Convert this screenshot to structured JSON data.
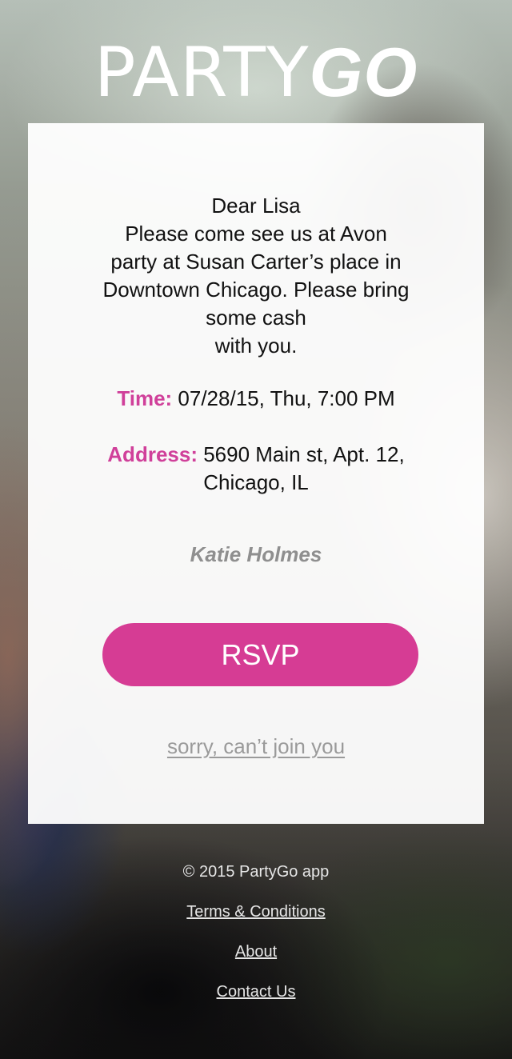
{
  "brand": {
    "logo_light": "PARTY",
    "logo_bold": "GO"
  },
  "invitation": {
    "greeting": "Dear Lisa",
    "lines": [
      "Please come see us at Avon",
      "party at Susan Carter’s place in",
      "Downtown Chicago. Please bring",
      "some cash",
      "with you."
    ],
    "time_label": "Time:",
    "time_value": " 07/28/15, Thu, 7:00 PM",
    "address_label": "Address:",
    "address_value_1": " 5690 Main st, Apt. 12,",
    "address_value_2": "Chicago, IL",
    "sender": "Katie Holmes",
    "rsvp_label": "RSVP",
    "decline_label": "sorry, can’t join you"
  },
  "footer": {
    "copyright": "© 2015 PartyGo app",
    "terms": "Terms & Conditions",
    "about": "About",
    "contact": "Contact Us"
  },
  "colors": {
    "accent": "#d63c94",
    "label": "#d0409a"
  }
}
